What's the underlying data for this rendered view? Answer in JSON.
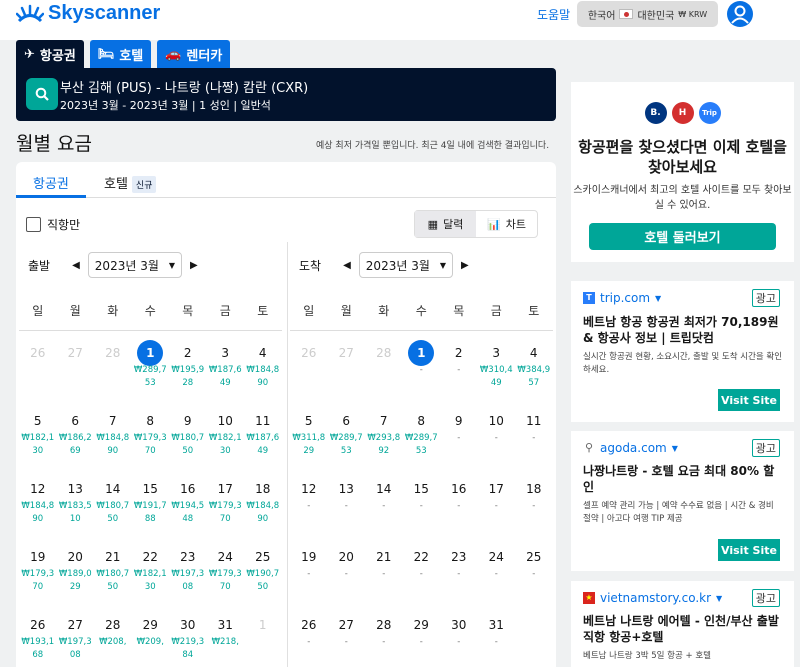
{
  "header": {
    "logo": "Skyscanner",
    "help": "도움말",
    "locale": "한국어",
    "region": "대한민국",
    "currency": "₩ KRW"
  },
  "tabs": [
    {
      "label": "항공권"
    },
    {
      "label": "호텔"
    },
    {
      "label": "렌터카"
    }
  ],
  "search": {
    "route": "부산 김해 (PUS) - 나트랑 (나짱) 캄란 (CXR)",
    "meta": "2023년 3월 - 2023년 3월 | 1 성인 | 일반석"
  },
  "page": {
    "title": "월별 요금",
    "note": "예상 최저 가격일 뿐입니다. 최근 4일 내에 검색한 결과입니다."
  },
  "panel": {
    "tab_flights": "항공권",
    "tab_hotels": "호텔",
    "new_badge": "신규",
    "direct_only": "직항만",
    "view_calendar": "달력",
    "view_chart": "차트"
  },
  "depart": {
    "label": "출발",
    "month": "2023년 3월"
  },
  "arrive": {
    "label": "도착",
    "month": "2023년 3월"
  },
  "dow": [
    "일",
    "월",
    "화",
    "수",
    "목",
    "금",
    "토"
  ],
  "cal_depart": [
    [
      {
        "d": "26",
        "p": "",
        "g": true
      },
      {
        "d": "27",
        "p": "",
        "g": true
      },
      {
        "d": "28",
        "p": "",
        "g": true
      },
      {
        "d": "1",
        "p": "₩289,753",
        "s": true
      },
      {
        "d": "2",
        "p": "₩195,928"
      },
      {
        "d": "3",
        "p": "₩187,649"
      },
      {
        "d": "4",
        "p": "₩184,890"
      }
    ],
    [
      {
        "d": "5",
        "p": "₩182,130"
      },
      {
        "d": "6",
        "p": "₩186,269"
      },
      {
        "d": "7",
        "p": "₩184,890"
      },
      {
        "d": "8",
        "p": "₩179,370"
      },
      {
        "d": "9",
        "p": "₩180,750"
      },
      {
        "d": "10",
        "p": "₩182,130"
      },
      {
        "d": "11",
        "p": "₩187,649"
      }
    ],
    [
      {
        "d": "12",
        "p": "₩184,890"
      },
      {
        "d": "13",
        "p": "₩183,510"
      },
      {
        "d": "14",
        "p": "₩180,750"
      },
      {
        "d": "15",
        "p": "₩191,788"
      },
      {
        "d": "16",
        "p": "₩194,548"
      },
      {
        "d": "17",
        "p": "₩179,370"
      },
      {
        "d": "18",
        "p": "₩184,890"
      }
    ],
    [
      {
        "d": "19",
        "p": "₩179,370"
      },
      {
        "d": "20",
        "p": "₩189,029"
      },
      {
        "d": "21",
        "p": "₩180,750"
      },
      {
        "d": "22",
        "p": "₩182,130"
      },
      {
        "d": "23",
        "p": "₩197,308"
      },
      {
        "d": "24",
        "p": "₩179,370"
      },
      {
        "d": "25",
        "p": "₩190,750"
      }
    ],
    [
      {
        "d": "26",
        "p": "₩193,168"
      },
      {
        "d": "27",
        "p": "₩197,308"
      },
      {
        "d": "28",
        "p": "₩208,"
      },
      {
        "d": "29",
        "p": "₩209,"
      },
      {
        "d": "30",
        "p": "₩219,384"
      },
      {
        "d": "31",
        "p": "₩218,"
      },
      {
        "d": "1",
        "p": "",
        "g": true
      }
    ]
  ],
  "cal_arrive": [
    [
      {
        "d": "26",
        "p": "",
        "g": true
      },
      {
        "d": "27",
        "p": "",
        "g": true
      },
      {
        "d": "28",
        "p": "",
        "g": true
      },
      {
        "d": "1",
        "p": "-",
        "s": true
      },
      {
        "d": "2",
        "p": "-"
      },
      {
        "d": "3",
        "p": "₩310,449"
      },
      {
        "d": "4",
        "p": "₩384,957"
      }
    ],
    [
      {
        "d": "5",
        "p": "₩311,829"
      },
      {
        "d": "6",
        "p": "₩289,753"
      },
      {
        "d": "7",
        "p": "₩293,892"
      },
      {
        "d": "8",
        "p": "₩289,753"
      },
      {
        "d": "9",
        "p": "-"
      },
      {
        "d": "10",
        "p": "-"
      },
      {
        "d": "11",
        "p": "-"
      }
    ],
    [
      {
        "d": "12",
        "p": "-"
      },
      {
        "d": "13",
        "p": "-"
      },
      {
        "d": "14",
        "p": "-"
      },
      {
        "d": "15",
        "p": "-"
      },
      {
        "d": "16",
        "p": "-"
      },
      {
        "d": "17",
        "p": "-"
      },
      {
        "d": "18",
        "p": "-"
      }
    ],
    [
      {
        "d": "19",
        "p": "-"
      },
      {
        "d": "20",
        "p": "-"
      },
      {
        "d": "21",
        "p": "-"
      },
      {
        "d": "22",
        "p": "-"
      },
      {
        "d": "23",
        "p": "-"
      },
      {
        "d": "24",
        "p": "-"
      },
      {
        "d": "25",
        "p": "-"
      }
    ],
    [
      {
        "d": "26",
        "p": "-"
      },
      {
        "d": "27",
        "p": "-"
      },
      {
        "d": "28",
        "p": "-"
      },
      {
        "d": "29",
        "p": "-"
      },
      {
        "d": "30",
        "p": "-"
      },
      {
        "d": "31",
        "p": "-"
      },
      {
        "d": "",
        "p": ""
      }
    ]
  ],
  "hotel_promo": {
    "logos": [
      "B.",
      "H",
      "Trip"
    ],
    "title": "항공편을 찾으셨다면 이제 호텔을 찾아보세요",
    "subtitle": "스카이스캐너에서 최고의 호텔 사이트를 모두 찾아보실 수 있어요.",
    "button": "호텔 둘러보기"
  },
  "ads": [
    {
      "site": "trip.com",
      "tag": "광고",
      "title": "베트남 항공 항공권 최저가 70,189원 & 항공사 정보 | 트립닷컴",
      "desc": "실시간 항공권 현황, 소요시간, 출발 및 도착 시간을 확인하세요.",
      "button": "Visit Site"
    },
    {
      "site": "agoda.com",
      "tag": "광고",
      "title": "나짱나트랑 - 호텔 요금 최대 80% 할인",
      "desc": "셀프 예약 관리 가능 | 예약 수수료 없음 | 시간 & 경비 절약 | 아고다 여행 TIP 제공",
      "button": "Visit Site"
    },
    {
      "site": "vietnamstory.co.kr",
      "tag": "광고",
      "title": "베트남 나트랑 에어텔 - 인천/부산 출발 직항 항공+호텔",
      "desc": "베트남 나트랑 3박 5일 항공 + 호텔"
    }
  ],
  "colors": {
    "brand": "#0770e3",
    "navy": "#02122c",
    "teal": "#00a698"
  }
}
